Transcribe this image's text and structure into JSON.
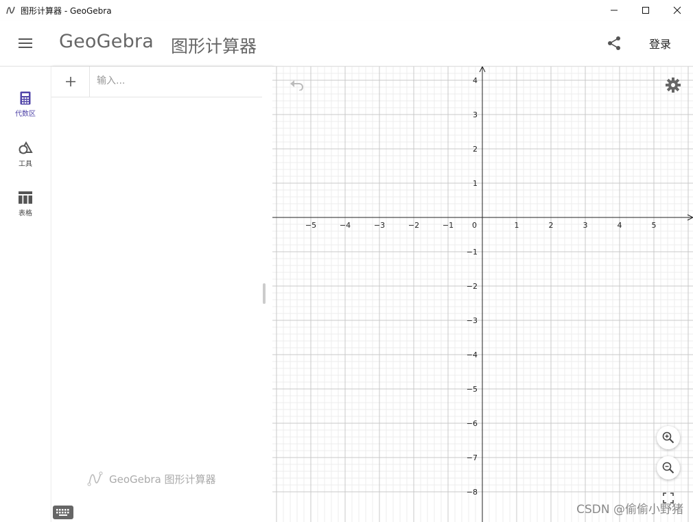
{
  "window": {
    "title": "图形计算器 - GeoGebra",
    "icon": "geogebra-app-icon",
    "controls": [
      "minimize-icon",
      "maximize-icon",
      "close-icon"
    ]
  },
  "header": {
    "logo_text": "GeoGebra",
    "app_name": "图形计算器",
    "login_label": "登录",
    "menu_icon": "hamburger-icon",
    "share_icon": "share-icon"
  },
  "rail": {
    "items": [
      {
        "label": "代数区",
        "icon": "calculator-icon",
        "active": true
      },
      {
        "label": "工具",
        "icon": "tools-shapes-icon",
        "active": false
      },
      {
        "label": "表格",
        "icon": "table-icon",
        "active": false
      }
    ],
    "active_color": "#5145a8"
  },
  "algebra": {
    "input_placeholder": "输入...",
    "input_value": "",
    "watermark": "GeoGebra 图形计算器"
  },
  "graphics": {
    "x_ticks": [
      "−5",
      "−4",
      "−3",
      "−2",
      "−1",
      "0",
      "1",
      "2",
      "3",
      "4",
      "5"
    ],
    "y_ticks_positive": [
      "4",
      "3",
      "2",
      "1"
    ],
    "y_ticks_negative": [
      "−1",
      "−2",
      "−3",
      "−4",
      "−5",
      "−6",
      "−7",
      "−8"
    ],
    "x_range": [
      -6,
      6
    ],
    "y_range": [
      -8.8,
      4.4
    ],
    "grid": true
  },
  "watermark": "CSDN @偷偷小野猪"
}
